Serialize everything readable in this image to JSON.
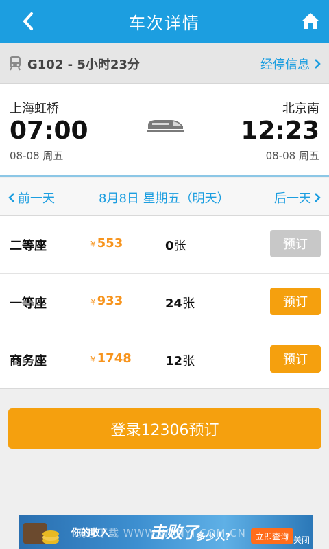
{
  "header": {
    "title": "车次详情",
    "back_icon": "chevron-left-icon",
    "home_icon": "home-icon"
  },
  "train": {
    "summary": "G102 - 5小时23分",
    "stops_link": "经停信息"
  },
  "journey": {
    "departure": {
      "station": "上海虹桥",
      "time": "07:00",
      "date": "08-08 周五"
    },
    "arrival": {
      "station": "北京南",
      "time": "12:23",
      "date": "08-08 周五"
    }
  },
  "date_nav": {
    "prev": "前一天",
    "current": "8月8日 星期五（明天）",
    "next": "后一天"
  },
  "seats": [
    {
      "type": "二等座",
      "currency": "¥",
      "price": "553",
      "count": "0",
      "unit": "张",
      "button": "预订",
      "available": false
    },
    {
      "type": "一等座",
      "currency": "¥",
      "price": "933",
      "count": "24",
      "unit": "张",
      "button": "预订",
      "available": true
    },
    {
      "type": "商务座",
      "currency": "¥",
      "price": "1748",
      "count": "12",
      "unit": "张",
      "button": "预订",
      "available": true
    }
  ],
  "login_button": "登录12306预订",
  "ad": {
    "left_text": "你的收入",
    "big_text": "击败了",
    "small_text": "多少人?",
    "button": "立即查询",
    "close": "关闭"
  },
  "watermark": "玩意下载 WWW.WANYI.COM.CN",
  "colors": {
    "primary": "#1c9ee0",
    "accent": "#f5a00e",
    "disabled": "#c8c8c8"
  }
}
